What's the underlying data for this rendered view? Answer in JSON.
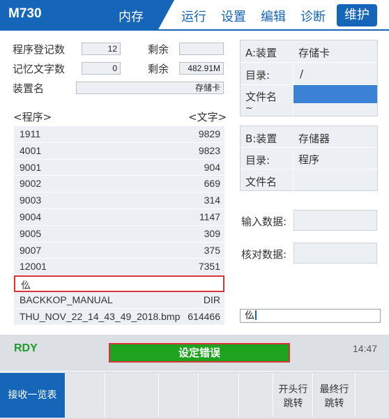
{
  "header": {
    "model": "M730",
    "memory_label": "内存",
    "menu": [
      "运行",
      "设置",
      "编辑",
      "诊断"
    ],
    "active_menu": "维护"
  },
  "summary": {
    "registered_programs_label": "程序登记数",
    "registered_programs_value": "12",
    "remaining_label_1": "剩余",
    "remaining_value_1": "",
    "memory_chars_label": "记忆文字数",
    "memory_chars_value": "0",
    "remaining_label_2": "剩余",
    "remaining_value_2": "482.91M",
    "device_name_label": "装置名",
    "device_name_value": "存储卡"
  },
  "list": {
    "program_header": "<程序>",
    "chars_header": "<文字>",
    "rows": [
      {
        "name": "1911",
        "size": "9829"
      },
      {
        "name": "4001",
        "size": "9823"
      },
      {
        "name": "9001",
        "size": "904"
      },
      {
        "name": "9002",
        "size": "669"
      },
      {
        "name": "9003",
        "size": "314"
      },
      {
        "name": "9004",
        "size": "1147"
      },
      {
        "name": "9005",
        "size": "309"
      },
      {
        "name": "9007",
        "size": "375"
      },
      {
        "name": "12001",
        "size": "7351"
      }
    ],
    "input_row_text": "仫",
    "extra_rows": [
      {
        "name": "BACKKOP_MANUAL",
        "size": "DIR"
      },
      {
        "name": "THU_NOV_22_14_43_49_2018.bmp",
        "size": "614466"
      }
    ]
  },
  "device_a": {
    "label": "A:装置",
    "device": "存储卡",
    "dir_label": "目录:",
    "dir_value": "/",
    "file_label": "文件名",
    "tilde": "~"
  },
  "device_b": {
    "label": "B:装置",
    "device": "存储器",
    "dir_label": "目录:",
    "dir_value": "程序",
    "file_label": "文件名"
  },
  "data_fields": {
    "input_label": "输入数据:",
    "verify_label": "核对数据:"
  },
  "cursor_input": "仫",
  "status": {
    "ready": "RDY",
    "alarm": "设定错误",
    "time": "14:47"
  },
  "softkeys": {
    "receive_list": "接收一览表",
    "start_line_1": "开头行",
    "start_line_2": "跳转",
    "end_line_1": "最终行",
    "end_line_2": "跳转"
  },
  "colors": {
    "accent_blue": "#1565b8",
    "alarm_green": "#1ea31e",
    "alarm_border": "#d8323a",
    "ready_green": "#1f9a2b"
  }
}
